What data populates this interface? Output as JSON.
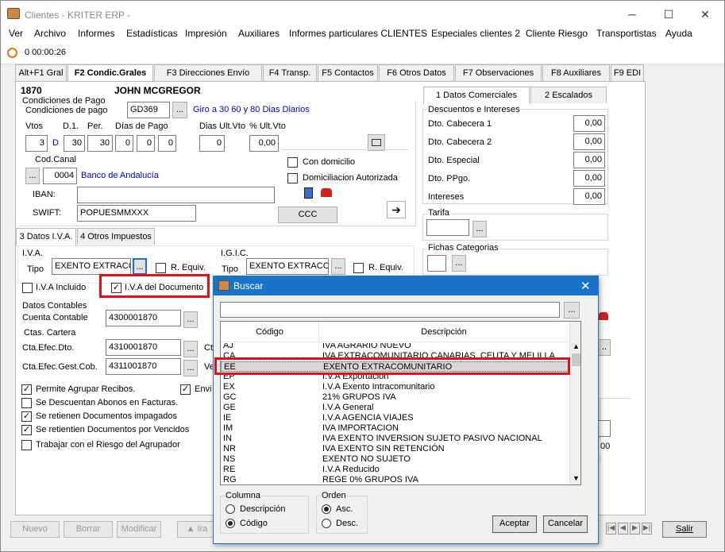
{
  "window": {
    "title": "Clientes - KRITER ERP -",
    "minimize": "─",
    "maximize": "☐",
    "close": "✕"
  },
  "menu": [
    "Ver",
    "Archivo",
    "Informes",
    "Estadísticas",
    "Impresión",
    "Auxiliares",
    "Informes particulares CLIENTES",
    "Especiales clientes 2",
    "Cliente Riesgo",
    "Transportistas",
    "Ayuda"
  ],
  "timer": "0 00:00:26",
  "tabs": [
    "Alt+F1 Gral",
    "F2 Condic.Grales",
    "F3 Direcciones Envío",
    "F4 Transp.",
    "F5 Contactos",
    "F6 Otros Datos",
    "F7 Observaciones",
    "F8 Auxiliares",
    "F9 EDI"
  ],
  "client": {
    "code": "1870",
    "name": "JOHN MCGREGOR"
  },
  "payment": {
    "group": "Condiciones de Pago",
    "label": "Condiciones de pago",
    "code": "GD369",
    "desc": "Giro a 30 60 y 80 Dias Diarios",
    "col_vtos": "Vtos",
    "col_d1": "D.1.",
    "col_per": "Per.",
    "col_dias": "Días de Pago",
    "col_ult": "Dias Ult.Vto",
    "col_pct": "% Ult.Vto",
    "vtos": "3",
    "d_flag": "D",
    "d1": "30",
    "per": "30",
    "dia1": "0",
    "dia2": "0",
    "dia3": "0",
    "ult": "0",
    "pct": "0,00",
    "cod_canal_label": "Cod.Canal",
    "canal_code": "0004",
    "canal_name": "Banco de Andalucía",
    "iban_label": "IBAN:",
    "iban": "",
    "swift_label": "SWIFT:",
    "swift": "POPUESMMXXX",
    "con_domicilio": "Con domicilio",
    "domiciliacion": "Domiciliacion Autorizada",
    "ccc": "CCC"
  },
  "right_tabs": [
    "1 Datos Comerciales",
    "2 Escalados"
  ],
  "discounts": {
    "group": "Descuentos e Intereses",
    "items": [
      {
        "label": "Dto. Cabecera 1",
        "value": "0,00"
      },
      {
        "label": "Dto. Cabecera 2",
        "value": "0,00"
      },
      {
        "label": "Dto. Especial",
        "value": "0,00"
      },
      {
        "label": "Dto. PPgo.",
        "value": "0,00"
      },
      {
        "label": "Intereses",
        "value": "0,00"
      }
    ]
  },
  "tarifa": "Tarifa",
  "fichas": "Fichas Categorias",
  "sub_tabs": [
    "3 Datos I.V.A.",
    "4 Otros Impuestos"
  ],
  "iva": {
    "group": "I.V.A.",
    "tipo_label": "Tipo",
    "tipo": "EXENTO EXTRACOM",
    "r_equiv": "R. Equiv.",
    "igic_group": "I.G.I.C.",
    "igic_tipo": "EXENTO EXTRACOM",
    "iva_incluido": "I.V.A Incluido",
    "iva_documento": "I.V.A del Documento"
  },
  "contables": {
    "group": "Datos Contables",
    "cuenta_label": "Cuenta Contable",
    "cuenta": "4300001870",
    "cartera_group": "Ctas. Cartera",
    "efec_label": "Cta.Efec.Dto.",
    "efec": "4310001870",
    "gest_label": "Cta.Efec.Gest.Cob.",
    "gest": "4311001870",
    "ct": "Ct",
    "ve": "Ve"
  },
  "checks": [
    {
      "label": "Permite Agrupar Recibos.",
      "checked": true
    },
    {
      "label": "Se Descuentan Abonos en Facturas.",
      "checked": false
    },
    {
      "label": "Se retienen Documentos impagados",
      "checked": true
    },
    {
      "label": "Se retientien Documentos por Vencidos",
      "checked": true
    },
    {
      "label": "Trabajar con el Riesgo del Agrupador",
      "checked": false
    }
  ],
  "envio_label": "Envi",
  "bottom": {
    "nuevo": "Nuevo",
    "borrar": "Borrar",
    "modificar": "Modificar",
    "ira": "▲ Ira",
    "salir": "Salir",
    "right_value": "00"
  },
  "dialog": {
    "title": "Buscar",
    "search": "",
    "col_codigo": "Código",
    "col_desc": "Descripción",
    "rows": [
      [
        "AJ",
        "IVA AGRARIO NUEVO"
      ],
      [
        "CA",
        "IVA EXTRACOMUNITARIO CANARIAS, CEUTA Y MELILLA"
      ],
      [
        "EE",
        "EXENTO EXTRACOMUNITARIO"
      ],
      [
        "EP",
        "I.V.A Exportacion"
      ],
      [
        "EX",
        "I.V.A Exento Intracomunitario"
      ],
      [
        "GC",
        "21% GRUPOS IVA"
      ],
      [
        "GE",
        "I.V.A General"
      ],
      [
        "IE",
        "I.V.A AGENCIA VIAJES"
      ],
      [
        "IM",
        "IVA IMPORTACION"
      ],
      [
        "IN",
        "IVA EXENTO INVERSION SUJETO PASIVO NACIONAL"
      ],
      [
        "NR",
        "IVA EXENTO SIN RETENCIÓN"
      ],
      [
        "NS",
        "EXENTO NO SUJETO"
      ],
      [
        "RE",
        "I.V.A Reducido"
      ],
      [
        "RG",
        "REGE 0% GRUPOS IVA"
      ]
    ],
    "selected_index": 2,
    "columna": "Columna",
    "col_opt1": "Descripción",
    "col_opt2": "Código",
    "orden": "Orden",
    "ord_opt1": "Asc.",
    "ord_opt2": "Desc.",
    "aceptar": "Aceptar",
    "cancelar": "Cancelar"
  }
}
